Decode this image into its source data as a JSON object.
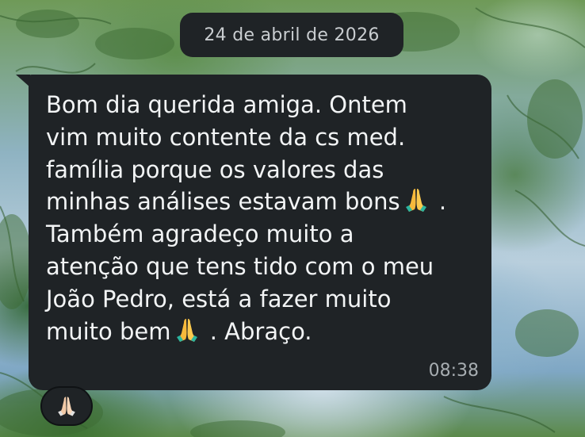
{
  "chat": {
    "date_divider": "24 de abril de 2026",
    "message": {
      "lines": [
        "Bom dia querida amiga. Ontem",
        "vim muito contente da cs med.",
        "família porque os valores das",
        "minhas análises estavam bons",
        " .",
        "Também agradeço muito a",
        "atenção que tens tido com o meu",
        "João Pedro, está a fazer muito",
        "muito bem",
        " . Abraço."
      ],
      "emoji": "folded-hands-icon",
      "time": "08:38"
    },
    "reaction": {
      "emoji": "folded-hands-icon"
    }
  }
}
